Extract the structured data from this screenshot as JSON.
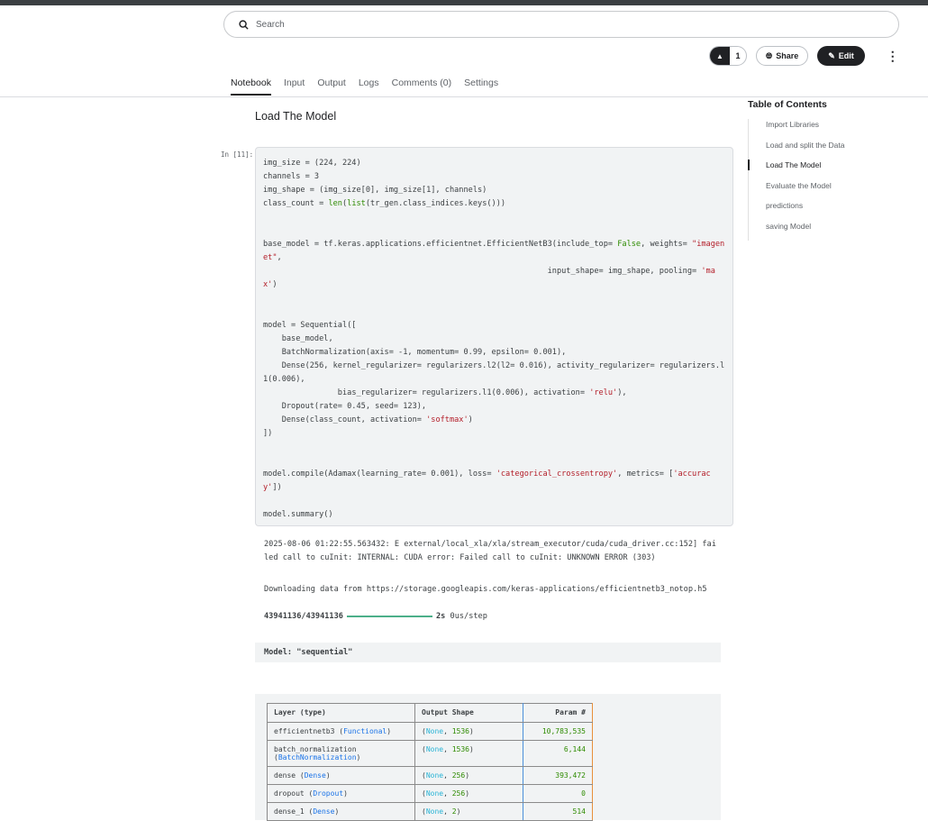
{
  "search": {
    "placeholder": "Search"
  },
  "actions": {
    "vote_count": "1",
    "share": "Share",
    "edit": "Edit"
  },
  "tabs": [
    "Notebook",
    "Input",
    "Output",
    "Logs",
    "Comments (0)",
    "Settings"
  ],
  "toc": {
    "title": "Table of Contents",
    "items": [
      "Import Libraries",
      "Load and split the Data",
      "Load The Model",
      "Evaluate the Model",
      "predictions",
      "saving Model"
    ],
    "active": 2
  },
  "section_title": "Load The Model",
  "cell_label": "In [11]:",
  "code_lines": [
    [
      [
        "img_size = (224, 224)",
        ""
      ]
    ],
    [
      [
        "channels = 3",
        ""
      ]
    ],
    [
      [
        "img_shape = (img_size[0], img_size[1], channels)",
        ""
      ]
    ],
    [
      [
        "class_count = ",
        ""
      ],
      [
        "len",
        "kw"
      ],
      [
        "(",
        ""
      ],
      [
        "list",
        "kw"
      ],
      [
        "(tr_gen.class_indices.keys()))",
        ""
      ]
    ],
    [
      [
        "",
        ""
      ]
    ],
    [
      [
        "",
        ""
      ]
    ],
    [
      [
        "base_model = tf.keras.applications.efficientnet.EfficientNetB3(include_top= ",
        ""
      ],
      [
        "False",
        "kw"
      ],
      [
        ", weights= ",
        ""
      ],
      [
        "\"imagenet\"",
        "str"
      ],
      [
        ",",
        ""
      ]
    ],
    [
      [
        "                                                             input_shape= img_shape, pooling= ",
        ""
      ],
      [
        "'max'",
        "str"
      ],
      [
        ")",
        ""
      ]
    ],
    [
      [
        "",
        ""
      ]
    ],
    [
      [
        "",
        ""
      ]
    ],
    [
      [
        "model = Sequential([",
        ""
      ]
    ],
    [
      [
        "    base_model,",
        ""
      ]
    ],
    [
      [
        "    BatchNormalization(axis= -1, momentum= 0.99, epsilon= 0.001),",
        ""
      ]
    ],
    [
      [
        "    Dense(256, kernel_regularizer= regularizers.l2(l2= 0.016), activity_regularizer= regularizers.l1(0.006),",
        ""
      ]
    ],
    [
      [
        "                bias_regularizer= regularizers.l1(0.006), activation= ",
        ""
      ],
      [
        "'relu'",
        "str"
      ],
      [
        "),",
        ""
      ]
    ],
    [
      [
        "    Dropout(rate= 0.45, seed= 123),",
        ""
      ]
    ],
    [
      [
        "    Dense(class_count, activation= ",
        ""
      ],
      [
        "'softmax'",
        "str"
      ],
      [
        ")",
        ""
      ]
    ],
    [
      [
        "])",
        ""
      ]
    ],
    [
      [
        "",
        ""
      ]
    ],
    [
      [
        "",
        ""
      ]
    ],
    [
      [
        "model.compile(Adamax(learning_rate= 0.001), loss= ",
        ""
      ],
      [
        "'categorical_crossentropy'",
        "str"
      ],
      [
        ", metrics= [",
        ""
      ],
      [
        "'accuracy'",
        "str"
      ],
      [
        "])",
        ""
      ]
    ],
    [
      [
        "",
        ""
      ]
    ],
    [
      [
        "model.summary()",
        ""
      ]
    ]
  ],
  "output": {
    "log1": "2025-08-06 01:22:55.563432: E external/local_xla/xla/stream_executor/cuda/cuda_driver.cc:152] failed call to cuInit: INTERNAL: CUDA error: Failed call to cuInit: UNKNOWN ERROR (303)",
    "download": "Downloading data from https://storage.googleapis.com/keras-applications/efficientnetb3_notop.h5",
    "progress_count": "43941136/43941136",
    "progress_fraction": 1.0,
    "progress_time": "2s",
    "progress_rate": "0us/step",
    "model_name": "Model: \"sequential\""
  },
  "summary": {
    "headers": [
      "Layer (type)",
      "Output Shape",
      "Param #"
    ],
    "rows": [
      {
        "name": "efficientnetb3",
        "type": "Functional",
        "shape": "1536",
        "params": "10,783,535"
      },
      {
        "name": "batch_normalization",
        "type": "BatchNormalization",
        "shape": "1536",
        "params": "6,144"
      },
      {
        "name": "dense",
        "type": "Dense",
        "shape": "256",
        "params": "393,472"
      },
      {
        "name": "dropout",
        "type": "Dropout",
        "shape": "256",
        "params": "0"
      },
      {
        "name": "dense_1",
        "type": "Dense",
        "shape": "2",
        "params": "514"
      }
    ]
  }
}
